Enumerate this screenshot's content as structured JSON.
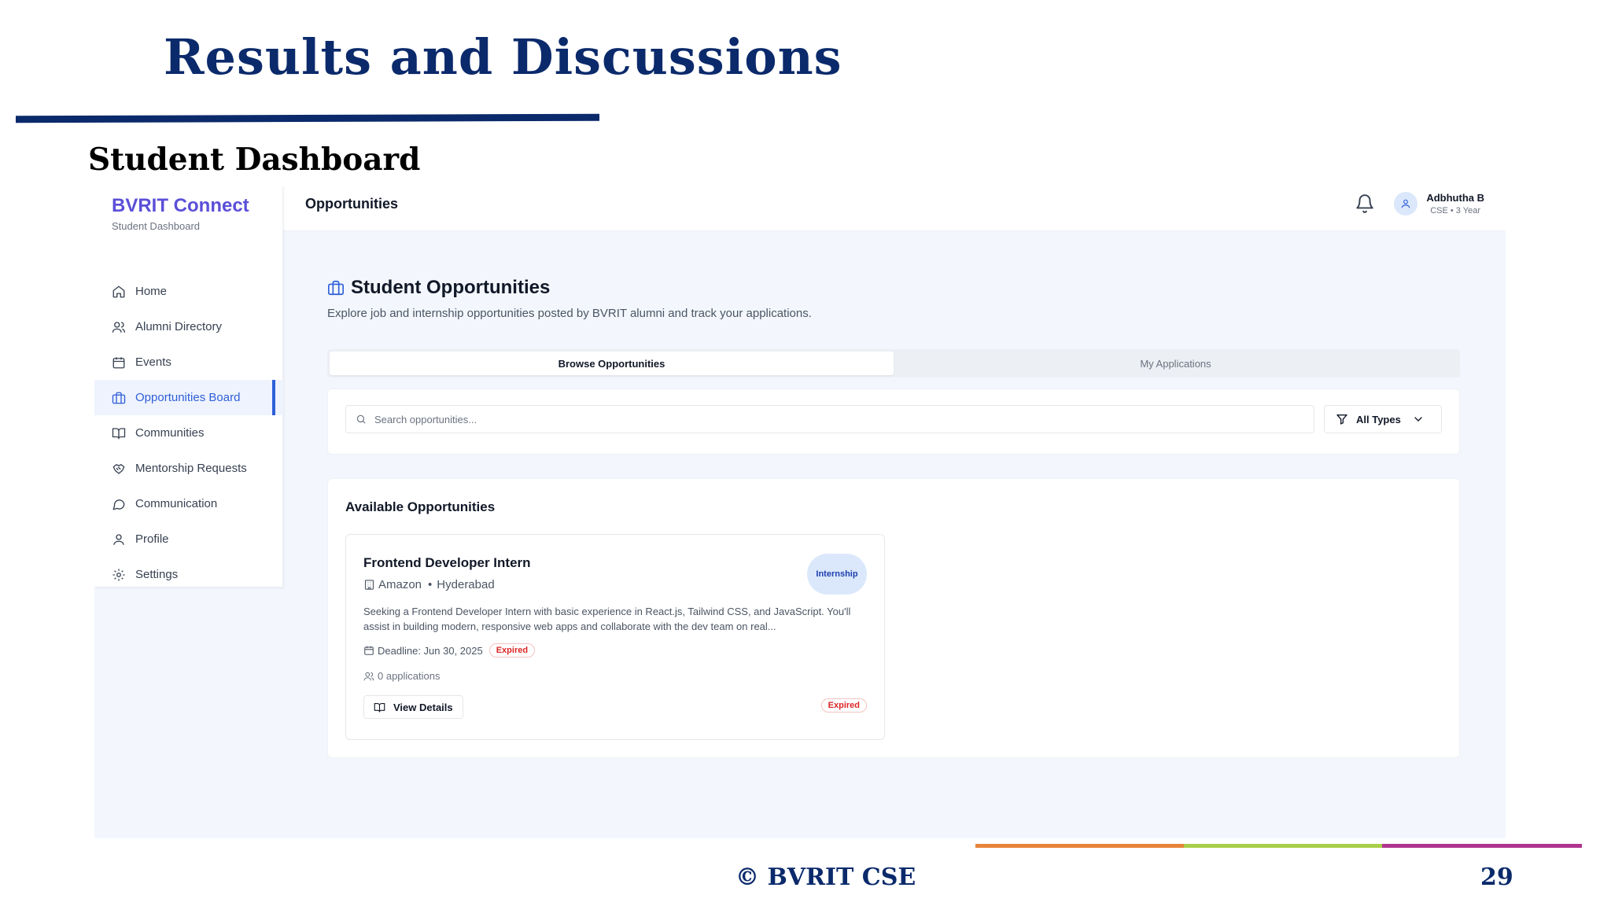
{
  "slide": {
    "title": "Results and Discussions",
    "subtitle": "Student Dashboard",
    "footer": "© BVRIT CSE",
    "page_number": "29",
    "colors": {
      "title": "#0b2a6b",
      "bar_orange": "#e8843a",
      "bar_green": "#a8cf4a",
      "bar_magenta": "#b0338f"
    }
  },
  "app": {
    "brand": "BVRIT Connect",
    "brand_sub": "Student Dashboard",
    "topbar_title": "Opportunities",
    "user": {
      "name": "Adbhutha B",
      "meta": "CSE • 3 Year"
    },
    "accent_color": "#2f5fd8"
  },
  "sidebar": {
    "items": [
      {
        "label": "Home",
        "icon": "home-icon"
      },
      {
        "label": "Alumni Directory",
        "icon": "users-icon"
      },
      {
        "label": "Events",
        "icon": "calendar-icon"
      },
      {
        "label": "Opportunities Board",
        "icon": "briefcase-icon",
        "active": true
      },
      {
        "label": "Communities",
        "icon": "book-open-icon"
      },
      {
        "label": "Mentorship Requests",
        "icon": "handshake-icon"
      },
      {
        "label": "Communication",
        "icon": "chat-icon"
      },
      {
        "label": "Profile",
        "icon": "user-icon"
      },
      {
        "label": "Settings",
        "icon": "gear-icon"
      }
    ]
  },
  "main": {
    "heading": "Student Opportunities",
    "description": "Explore job and internship opportunities posted by BVRIT alumni and track your applications.",
    "tabs": [
      {
        "label": "Browse Opportunities",
        "active": true
      },
      {
        "label": "My Applications",
        "active": false
      }
    ],
    "search": {
      "placeholder": "Search opportunities...",
      "value": ""
    },
    "filter": {
      "selected": "All Types"
    },
    "available_title": "Available Opportunities",
    "opportunity": {
      "title": "Frontend Developer Intern",
      "type": "Internship",
      "company": "Amazon",
      "location": "Hyderabad",
      "description": "Seeking a Frontend Developer Intern with basic experience in React.js, Tailwind CSS, and JavaScript. You'll assist in building modern, responsive web apps and collaborate with the dev team on real...",
      "deadline": "Deadline: Jun 30, 2025",
      "status": "Expired",
      "applications": "0 applications",
      "view_button": "View Details"
    }
  }
}
